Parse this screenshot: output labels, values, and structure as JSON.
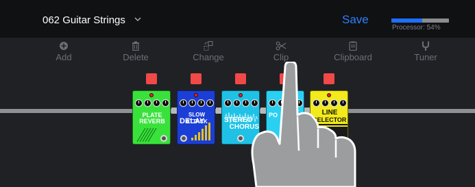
{
  "header": {
    "preset_name": "062 Guitar Strings",
    "save_label": "Save",
    "processor_label": "Processor: 54%",
    "processor_fraction": 0.54
  },
  "toolbar": {
    "add": "Add",
    "delete": "Delete",
    "change": "Change",
    "clip": "Clip",
    "clipboard": "Clipboard",
    "tuner": "Tuner"
  },
  "pedals": [
    {
      "line1": "PLATE",
      "line2": "REVERB",
      "color": "#39e23b"
    },
    {
      "line1": "SLOW ATTACK",
      "line2": "DELAY",
      "color": "#1b3fd6"
    },
    {
      "line1": "STEREO",
      "line2": "CHORUS",
      "color": "#1fc2e6"
    },
    {
      "line1": "PO",
      "line2": "C",
      "color": "#2ad0f2"
    },
    {
      "line1": "LINE",
      "line2": "SELECTOR",
      "color": "#f2ea1a"
    }
  ],
  "colors": {
    "accent": "#2f80ff",
    "marker": "#f14848"
  }
}
